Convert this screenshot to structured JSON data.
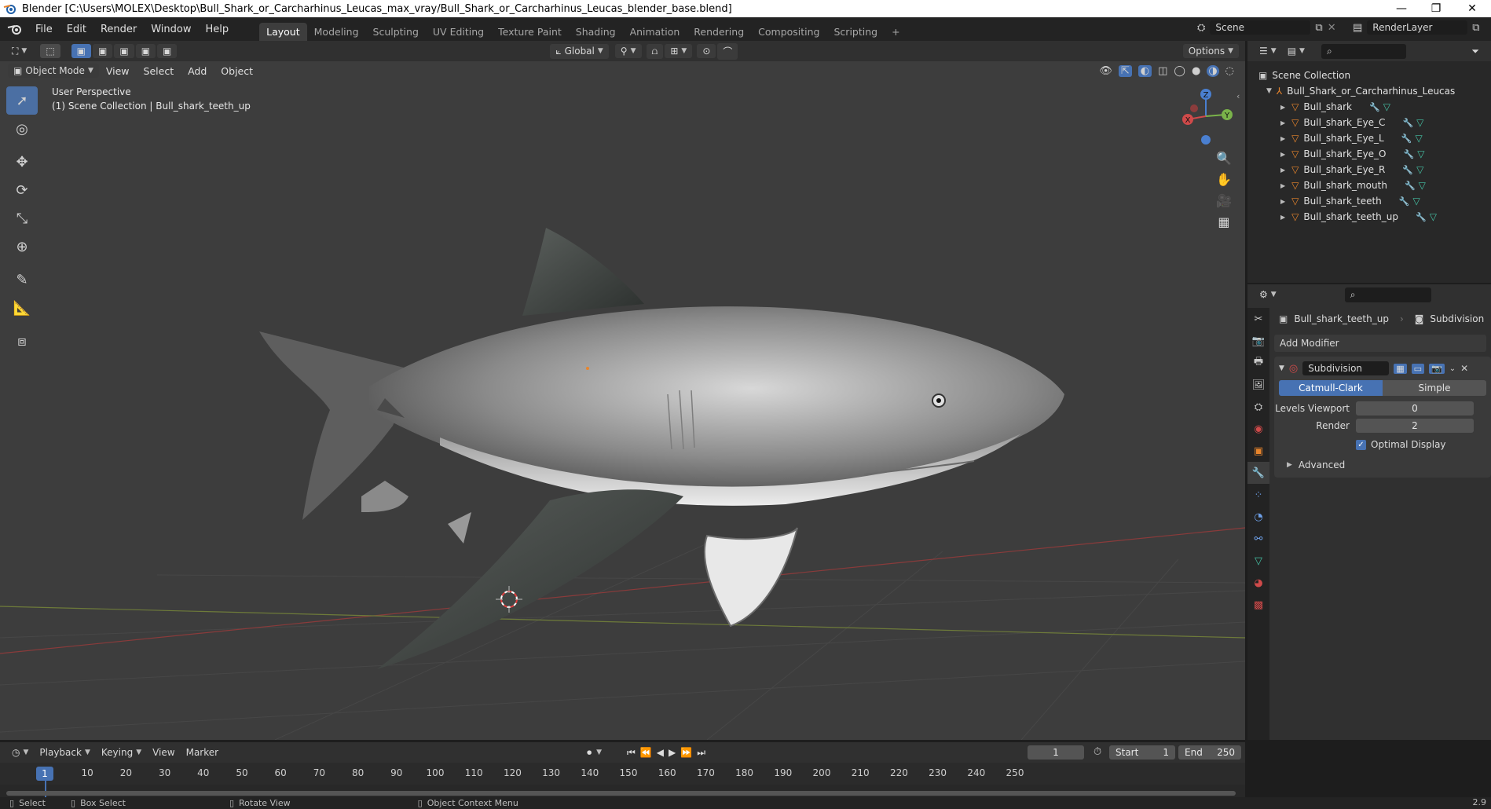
{
  "window": {
    "title": "Blender [C:\\Users\\MOLEX\\Desktop\\Bull_Shark_or_Carcharhinus_Leucas_max_vray/Bull_Shark_or_Carcharhinus_Leucas_blender_base.blend]",
    "minimize": "—",
    "restore": "❐",
    "close": "✕"
  },
  "menu": {
    "file": "File",
    "edit": "Edit",
    "render": "Render",
    "window": "Window",
    "help": "Help"
  },
  "workspaces": [
    "Layout",
    "Modeling",
    "Sculpting",
    "UV Editing",
    "Texture Paint",
    "Shading",
    "Animation",
    "Rendering",
    "Compositing",
    "Scripting"
  ],
  "workspace_add": "+",
  "scene": {
    "name": "Scene",
    "render_layer": "RenderLayer"
  },
  "viewport_header": {
    "transform_orientation": "Global",
    "options": "Options",
    "mode": "Object Mode",
    "view": "View",
    "select": "Select",
    "add": "Add",
    "object": "Object"
  },
  "viewport_overlay": {
    "perspective": "User Perspective",
    "collection_info": "(1) Scene Collection | Bull_shark_teeth_up"
  },
  "gizmo": {
    "x": "X",
    "y": "Y",
    "z": "Z"
  },
  "outliner": {
    "root": "Scene Collection",
    "collection": "Bull_Shark_or_Carcharhinus_Leucas",
    "objects": [
      "Bull_shark",
      "Bull_shark_Eye_C",
      "Bull_shark_Eye_L",
      "Bull_shark_Eye_O",
      "Bull_shark_Eye_R",
      "Bull_shark_mouth",
      "Bull_shark_teeth",
      "Bull_shark_teeth_up"
    ]
  },
  "properties": {
    "object_name": "Bull_shark_teeth_up",
    "modifier_crumb": "Subdivision",
    "add_modifier": "Add Modifier",
    "modifier_name": "Subdivision",
    "method_catmull": "Catmull-Clark",
    "method_simple": "Simple",
    "levels_viewport_label": "Levels Viewport",
    "levels_viewport_value": "0",
    "render_label": "Render",
    "render_value": "2",
    "optimal_display": "Optimal Display",
    "advanced": "Advanced"
  },
  "timeline": {
    "playback": "Playback",
    "keying": "Keying",
    "view": "View",
    "marker": "Marker",
    "current_frame": "1",
    "start_label": "Start",
    "start_value": "1",
    "end_label": "End",
    "end_value": "250",
    "ruler_current": "1",
    "ruler_ticks": [
      "10",
      "20",
      "30",
      "40",
      "50",
      "60",
      "70",
      "80",
      "90",
      "100",
      "110",
      "120",
      "130",
      "140",
      "150",
      "160",
      "170",
      "180",
      "190",
      "200",
      "210",
      "220",
      "230",
      "240",
      "250"
    ]
  },
  "statusbar": {
    "select": "Select",
    "box_select": "Box Select",
    "rotate_view": "Rotate View",
    "context_menu": "Object Context Menu",
    "version": "2.9"
  },
  "colors": {
    "accent": "#4772b3",
    "viewport_bg": "#3d3d3d",
    "orange": "#e8852c",
    "teal": "#45c2a5"
  }
}
